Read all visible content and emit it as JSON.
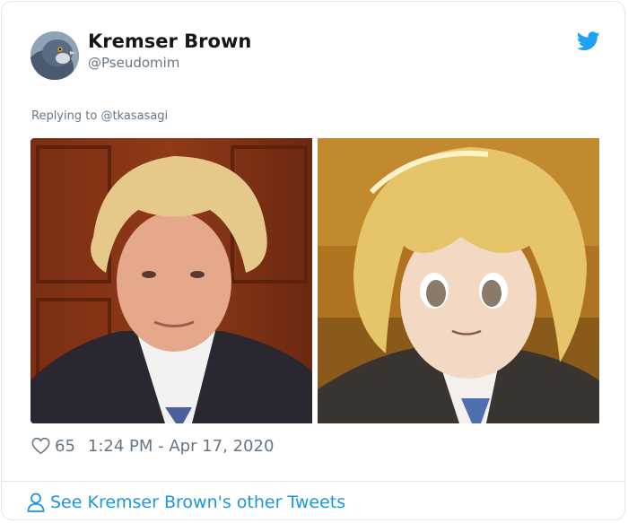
{
  "author": {
    "name": "Kremser Brown",
    "handle": "@Pseudomim",
    "avatar_icon": "pigeon-avatar"
  },
  "platform_icon": "twitter-bird-icon",
  "reply": {
    "prefix": "Replying to",
    "handle": "@tkasasagi"
  },
  "media": [
    {
      "kind": "photo",
      "description_icon": "man-portrait-photo"
    },
    {
      "kind": "illustration",
      "description_icon": "anime-portrait-illustration"
    }
  ],
  "meta": {
    "likes": "65",
    "timestamp": "1:24 PM - Apr 17, 2020"
  },
  "footer": {
    "label": "See Kremser Brown's other Tweets"
  },
  "colors": {
    "link_blue": "#1b95e0",
    "secondary_text": "#657786",
    "border": "#e1e8ed"
  }
}
